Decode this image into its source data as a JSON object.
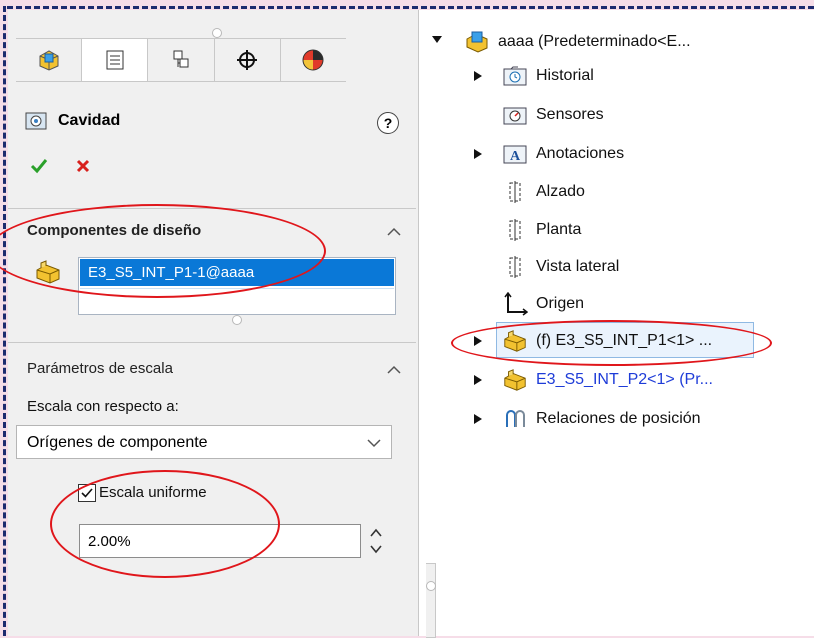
{
  "property_manager": {
    "tabs": [
      "feature-manager-icon",
      "property-manager-icon",
      "configuration-manager-icon",
      "dimxpert-icon",
      "display-manager-icon"
    ],
    "title": "Cavidad",
    "help_label": "?",
    "ok_label": "✔",
    "cancel_label": "✖",
    "design_components": {
      "title": "Componentes de diseño",
      "selected_item": "E3_S5_INT_P1-1@aaaa"
    },
    "scale_parameters": {
      "title": "Parámetros de escala",
      "scale_about_label": "Escala con respecto a:",
      "scale_about_value": "Orígenes de componente",
      "uniform_scale_label": "Escala uniforme",
      "uniform_scale_checked": true,
      "scale_value": "2.00%"
    }
  },
  "tree": {
    "root": "aaaa  (Predeterminado<E...",
    "items": [
      {
        "label": "Historial",
        "expandable": true
      },
      {
        "label": "Sensores",
        "expandable": false
      },
      {
        "label": "Anotaciones",
        "expandable": true
      },
      {
        "label": "Alzado",
        "expandable": false
      },
      {
        "label": "Planta",
        "expandable": false
      },
      {
        "label": "Vista lateral",
        "expandable": false
      },
      {
        "label": "Origen",
        "expandable": false
      },
      {
        "label": "(f) E3_S5_INT_P1<1> ...",
        "expandable": true,
        "selected": true
      },
      {
        "label": "E3_S5_INT_P2<1> (Pr...",
        "expandable": true,
        "color": "#1e3cd8"
      },
      {
        "label": "Relaciones de posición",
        "expandable": true
      }
    ]
  },
  "colors": {
    "accent_selection": "#0a78d7",
    "annotation_red": "#e0161b",
    "part_yellow": "#f2c230",
    "blue_text": "#1e3cd8"
  }
}
